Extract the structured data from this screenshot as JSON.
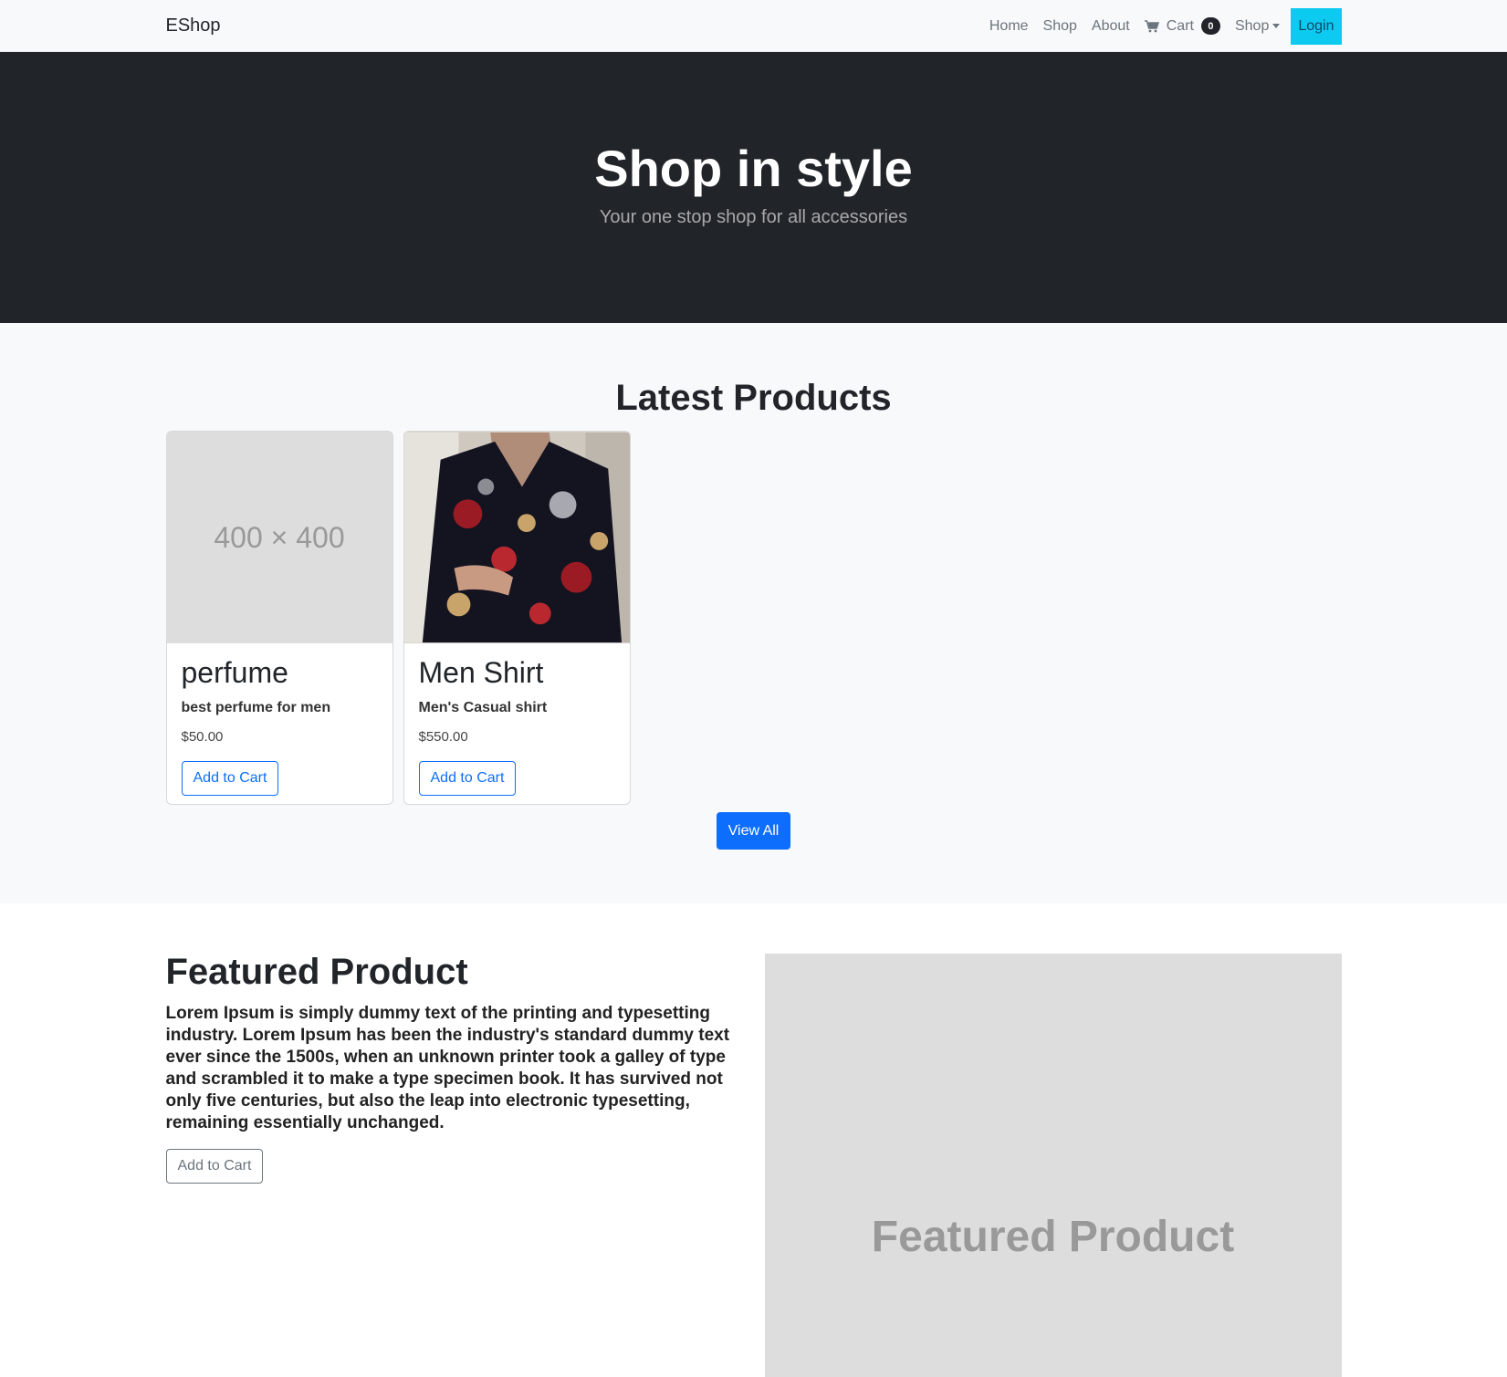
{
  "navbar": {
    "brand": "EShop",
    "links": [
      "Home",
      "Shop",
      "About"
    ],
    "cart_label": "Cart",
    "cart_count": "0",
    "dropdown_label": "Shop",
    "login_label": "Login"
  },
  "hero": {
    "title": "Shop in style",
    "subtitle": "Your one stop shop for all accessories"
  },
  "latest": {
    "heading": "Latest Products",
    "products": [
      {
        "image_text": "400 × 400",
        "title": "perfume",
        "subtitle": "best perfume for men",
        "price": "$50.00",
        "button": "Add to Cart"
      },
      {
        "title": "Men Shirt",
        "subtitle": "Men's Casual shirt",
        "price": "$550.00",
        "button": "Add to Cart"
      }
    ],
    "view_all_label": "View All"
  },
  "featured": {
    "heading": "Featured Product",
    "description": "Lorem Ipsum is simply dummy text of the printing and typesetting industry. Lorem Ipsum has been the industry's standard dummy text ever since the 1500s, when an unknown printer took a galley of type and scrambled it to make a type specimen book. It has survived not only five centuries, but also the leap into electronic typesetting, remaining essentially unchanged.",
    "button": "Add to Cart",
    "image_text": "Featured Product"
  },
  "colors": {
    "primary": "#0d6efd",
    "info": "#0dcaf0",
    "dark": "#212529",
    "light": "#f8f9fa"
  }
}
